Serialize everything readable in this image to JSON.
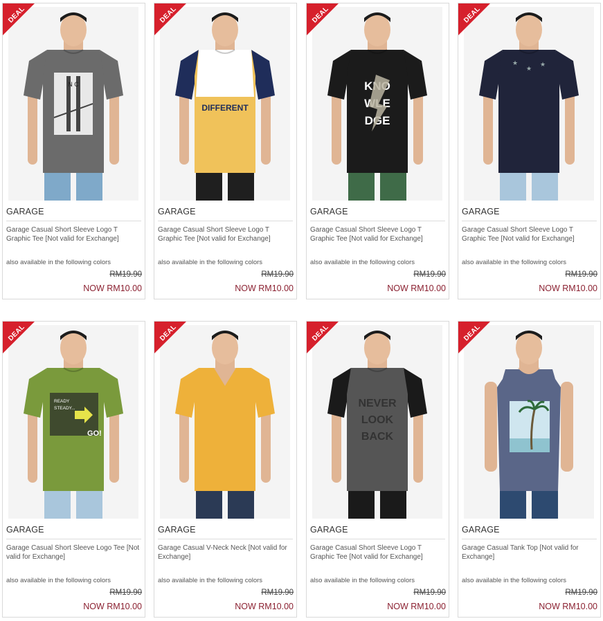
{
  "deal_label": "DEAL",
  "colors_note": "also available in the following colors",
  "products": [
    {
      "brand": "GARAGE",
      "name": "Garage Casual Short Sleeve Logo T Graphic Tee [Not valid for Exchange]",
      "old_price": "RM19.90",
      "now_price": "NOW RM10.00",
      "shirt_color": "#6b6b6b",
      "pants_color": "#7fa9c9",
      "graphic": "bridge",
      "graphic_text": "N  C"
    },
    {
      "brand": "GARAGE",
      "name": "Garage Casual Short Sleeve Logo T Graphic Tee [Not valid for Exchange]",
      "old_price": "RM19.90",
      "now_price": "NOW RM10.00",
      "shirt_color": "#f0c25a",
      "pants_color": "#1f1f1f",
      "graphic": "raglan",
      "graphic_text": "DIFFERENT"
    },
    {
      "brand": "GARAGE",
      "name": "Garage Casual Short Sleeve Logo T Graphic Tee [Not valid for Exchange]",
      "old_price": "RM19.90",
      "now_price": "NOW RM10.00",
      "shirt_color": "#1b1b1b",
      "pants_color": "#3f6b48",
      "graphic": "knowledge",
      "graphic_text": "KNOWLEDGE"
    },
    {
      "brand": "GARAGE",
      "name": "Garage Casual Short Sleeve Logo T Graphic Tee [Not valid for Exchange]",
      "old_price": "RM19.90",
      "now_price": "NOW RM10.00",
      "shirt_color": "#20243a",
      "pants_color": "#a9c6dc",
      "graphic": "stars",
      "graphic_text": ""
    },
    {
      "brand": "GARAGE",
      "name": "Garage Casual Short Sleeve Logo Tee [Not valid for Exchange]",
      "old_price": "RM19.90",
      "now_price": "NOW RM10.00",
      "shirt_color": "#7a9a3c",
      "pants_color": "#a9c6dc",
      "graphic": "ready",
      "graphic_text": "READY STEADY... GO!"
    },
    {
      "brand": "GARAGE",
      "name": "Garage Casual V-Neck Neck [Not valid for Exchange]",
      "old_price": "RM19.90",
      "now_price": "NOW RM10.00",
      "shirt_color": "#eeb13a",
      "pants_color": "#2b3a55",
      "graphic": "plain",
      "graphic_text": ""
    },
    {
      "brand": "GARAGE",
      "name": "Garage Casual Short Sleeve Logo T Graphic Tee [Not valid for Exchange]",
      "old_price": "RM19.90",
      "now_price": "NOW RM10.00",
      "shirt_color": "#555555",
      "pants_color": "#1a1a1a",
      "graphic": "never",
      "graphic_text": "NEVER LOOK BACK"
    },
    {
      "brand": "GARAGE",
      "name": "Garage Casual Tank Top [Not valid for Exchange]",
      "old_price": "RM19.90",
      "now_price": "NOW RM10.00",
      "shirt_color": "#5a6688",
      "pants_color": "#2d4a70",
      "graphic": "palm",
      "graphic_text": ""
    }
  ]
}
